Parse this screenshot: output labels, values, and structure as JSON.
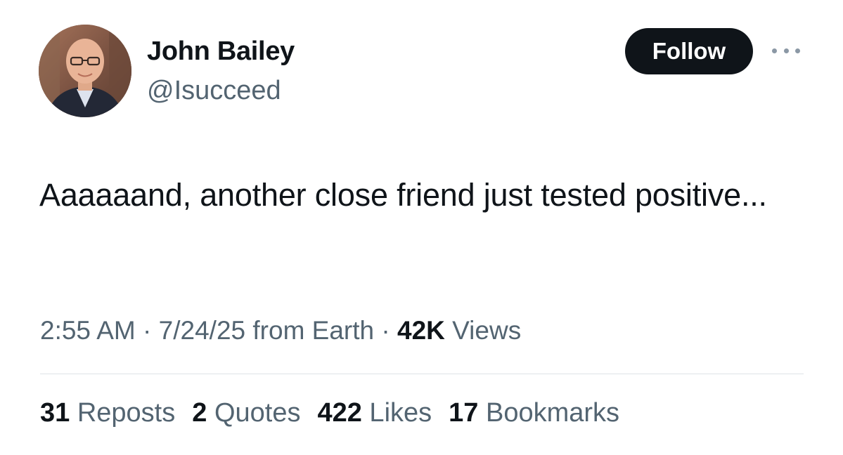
{
  "author": {
    "display_name": "John Bailey",
    "handle": "@Isucceed",
    "avatar_icon": "profile-photo"
  },
  "actions": {
    "follow_label": "Follow",
    "more_icon": "more-horizontal-icon"
  },
  "tweet": {
    "text": "Aaaaaand, another close friend just tested positive..."
  },
  "meta": {
    "time": "2:55 AM",
    "sep1": " · ",
    "date": "7/24/25",
    "source": " from Earth",
    "sep2": " · ",
    "views_count": "42K",
    "views_label": " Views"
  },
  "stats": {
    "reposts": {
      "count": "31",
      "label": " Reposts"
    },
    "quotes": {
      "count": "2",
      "label": " Quotes"
    },
    "likes": {
      "count": "422",
      "label": " Likes"
    },
    "bookmarks": {
      "count": "17",
      "label": " Bookmarks"
    }
  },
  "colors": {
    "text_primary": "#0f1419",
    "text_secondary": "#536471",
    "follow_bg": "#0f1419",
    "divider": "#dfe3e6"
  }
}
